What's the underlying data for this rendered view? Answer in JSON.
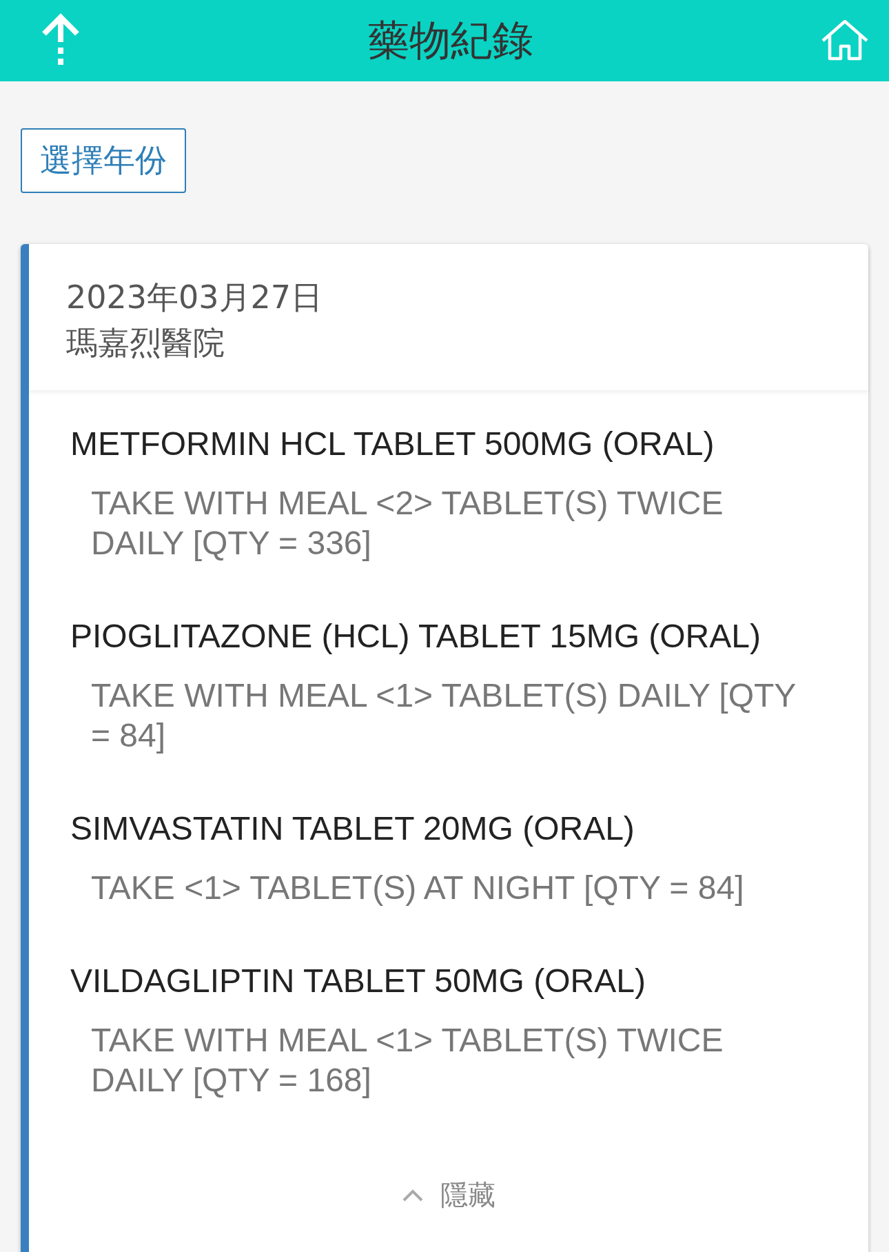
{
  "header": {
    "title": "藥物紀錄"
  },
  "year_button": {
    "label": "選擇年份"
  },
  "record": {
    "date": "2023年03月27日",
    "hospital": "瑪嘉烈醫院",
    "medications": [
      {
        "name": "METFORMIN HCL TABLET 500MG (ORAL)",
        "instructions": "TAKE WITH MEAL <2> TABLET(S) TWICE DAILY [QTY = 336]"
      },
      {
        "name": "PIOGLITAZONE (HCL) TABLET 15MG (ORAL)",
        "instructions": "TAKE WITH MEAL <1> TABLET(S) DAILY [QTY = 84]"
      },
      {
        "name": "SIMVASTATIN TABLET 20MG (ORAL)",
        "instructions": "TAKE <1> TABLET(S) AT NIGHT [QTY = 84]"
      },
      {
        "name": "VILDAGLIPTIN TABLET 50MG (ORAL)",
        "instructions": "TAKE WITH MEAL <1> TABLET(S) TWICE DAILY [QTY = 168]"
      }
    ],
    "toggle": {
      "label": "隱藏"
    }
  }
}
